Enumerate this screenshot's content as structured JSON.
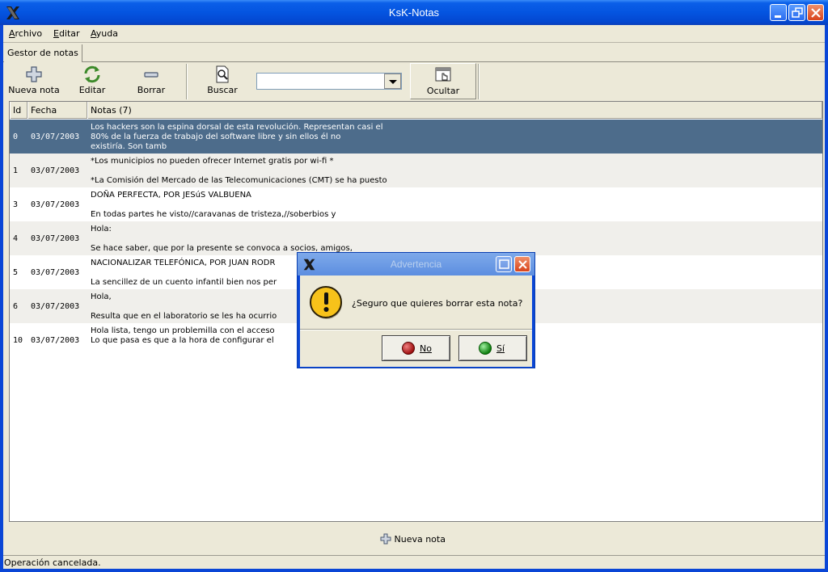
{
  "window": {
    "title": "KsK-Notas"
  },
  "menu": {
    "items": [
      "Archivo",
      "Editar",
      "Ayuda"
    ]
  },
  "tabs": {
    "active": "Gestor de notas"
  },
  "toolbar": {
    "new_note": "Nueva nota",
    "edit": "Editar",
    "delete": "Borrar",
    "search": "Buscar",
    "search_value": "",
    "hide": "Ocultar"
  },
  "list": {
    "headers": {
      "id": "Id",
      "date": "Fecha",
      "notes": "Notas (7)"
    },
    "rows": [
      {
        "id": "0",
        "date": "03/07/2003",
        "note": "Los hackers son la espina dorsal de esta revolución. Representan casi el\n80% de la fuerza de trabajo del software libre y sin ellos él no\nexistiría. Son tamb"
      },
      {
        "id": "1",
        "date": "03/07/2003",
        "note": "*Los municipios no pueden ofrecer Internet gratis por wi-fi *\n\n*La Comisión del Mercado de las Telecomunicaciones (CMT) se ha puesto"
      },
      {
        "id": "3",
        "date": "03/07/2003",
        "note": "DOÑA PERFECTA, POR JESúS VALBUENA\n\nEn todas partes he visto//caravanas de tristeza,//soberbios y"
      },
      {
        "id": "4",
        "date": "03/07/2003",
        "note": "Hola:\n\nSe hace saber, que por la presente se convoca a socios, amigos,"
      },
      {
        "id": "5",
        "date": "03/07/2003",
        "note": "NACIONALIZAR TELEFÓNICA, POR JUAN RODR\n\nLa sencillez de un cuento infantil bien nos per"
      },
      {
        "id": "6",
        "date": "03/07/2003",
        "note": "Hola,\n\nResulta que en el laboratorio se les ha ocurrio"
      },
      {
        "id": "10",
        "date": "03/07/2003",
        "note": "Hola lista, tengo un problemilla con el acceso\nLo que pasa es que a la hora de configurar el"
      }
    ]
  },
  "bottom": {
    "new_note": "Nueva nota"
  },
  "status": {
    "text": "Operación cancelada."
  },
  "dialog": {
    "title": "Advertencia",
    "message": "¿Seguro que quieres borrar esta nota?",
    "no_label": "No",
    "yes_label": "Sí"
  }
}
